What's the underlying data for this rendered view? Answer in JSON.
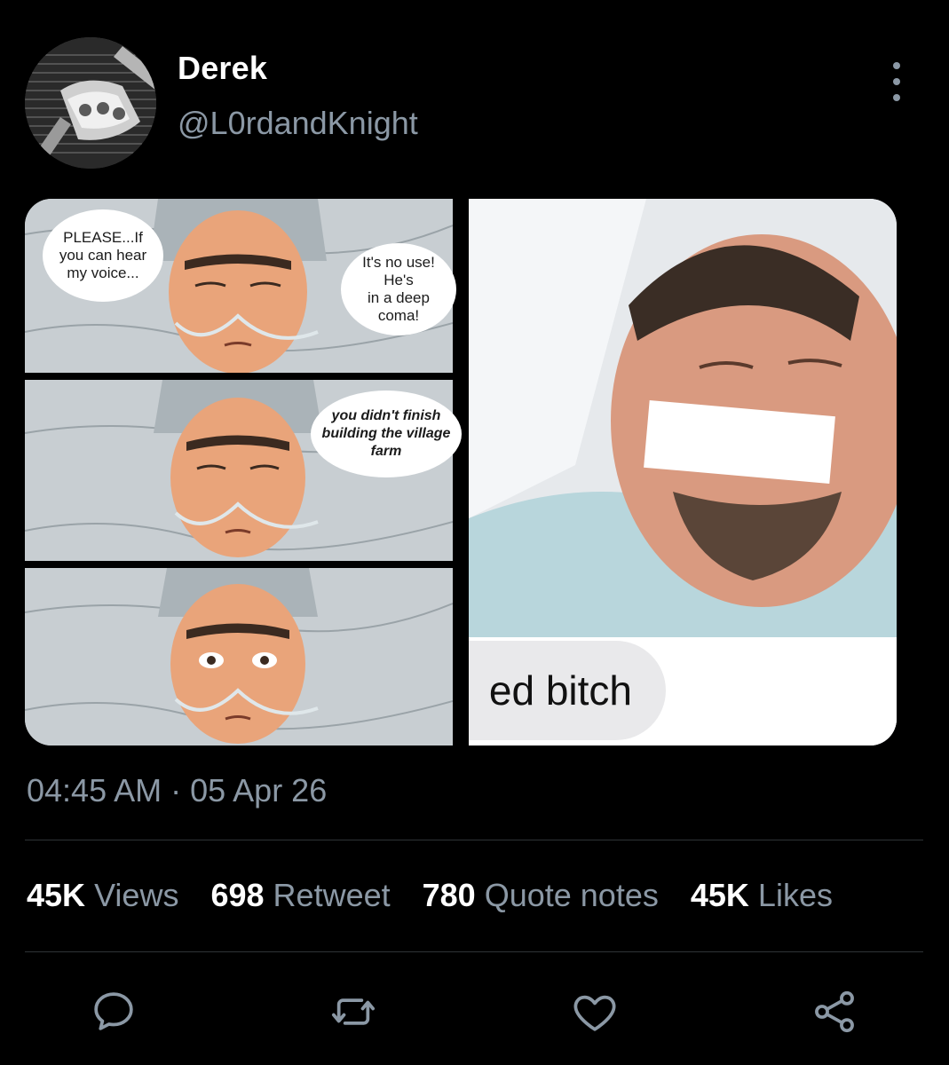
{
  "author": {
    "display_name": "Derek",
    "handle": "@L0rdandKnight"
  },
  "media": {
    "comic_bubbles": [
      "PLEASE...If\nyou can hear\nmy voice...",
      "It's no use! He's\nin a deep coma!",
      "you didn't finish\nbuilding the village\nfarm"
    ],
    "photo_caption": "ed bitch"
  },
  "timestamp": "04:45 AM · 05 Apr 26",
  "stats": {
    "views": {
      "value": "45K",
      "label": "Views"
    },
    "retweets": {
      "value": "698",
      "label": "Retweet"
    },
    "quotes": {
      "value": "780",
      "label": "Quote notes"
    },
    "likes": {
      "value": "45K",
      "label": "Likes"
    }
  },
  "icons": {
    "more": "more-vertical-icon",
    "reply": "reply-icon",
    "retweet": "retweet-icon",
    "like": "heart-icon",
    "share": "share-icon"
  },
  "colors": {
    "background": "#000000",
    "primary_text": "#ffffff",
    "secondary_text": "#8b98a5",
    "divider": "#2f3336"
  }
}
